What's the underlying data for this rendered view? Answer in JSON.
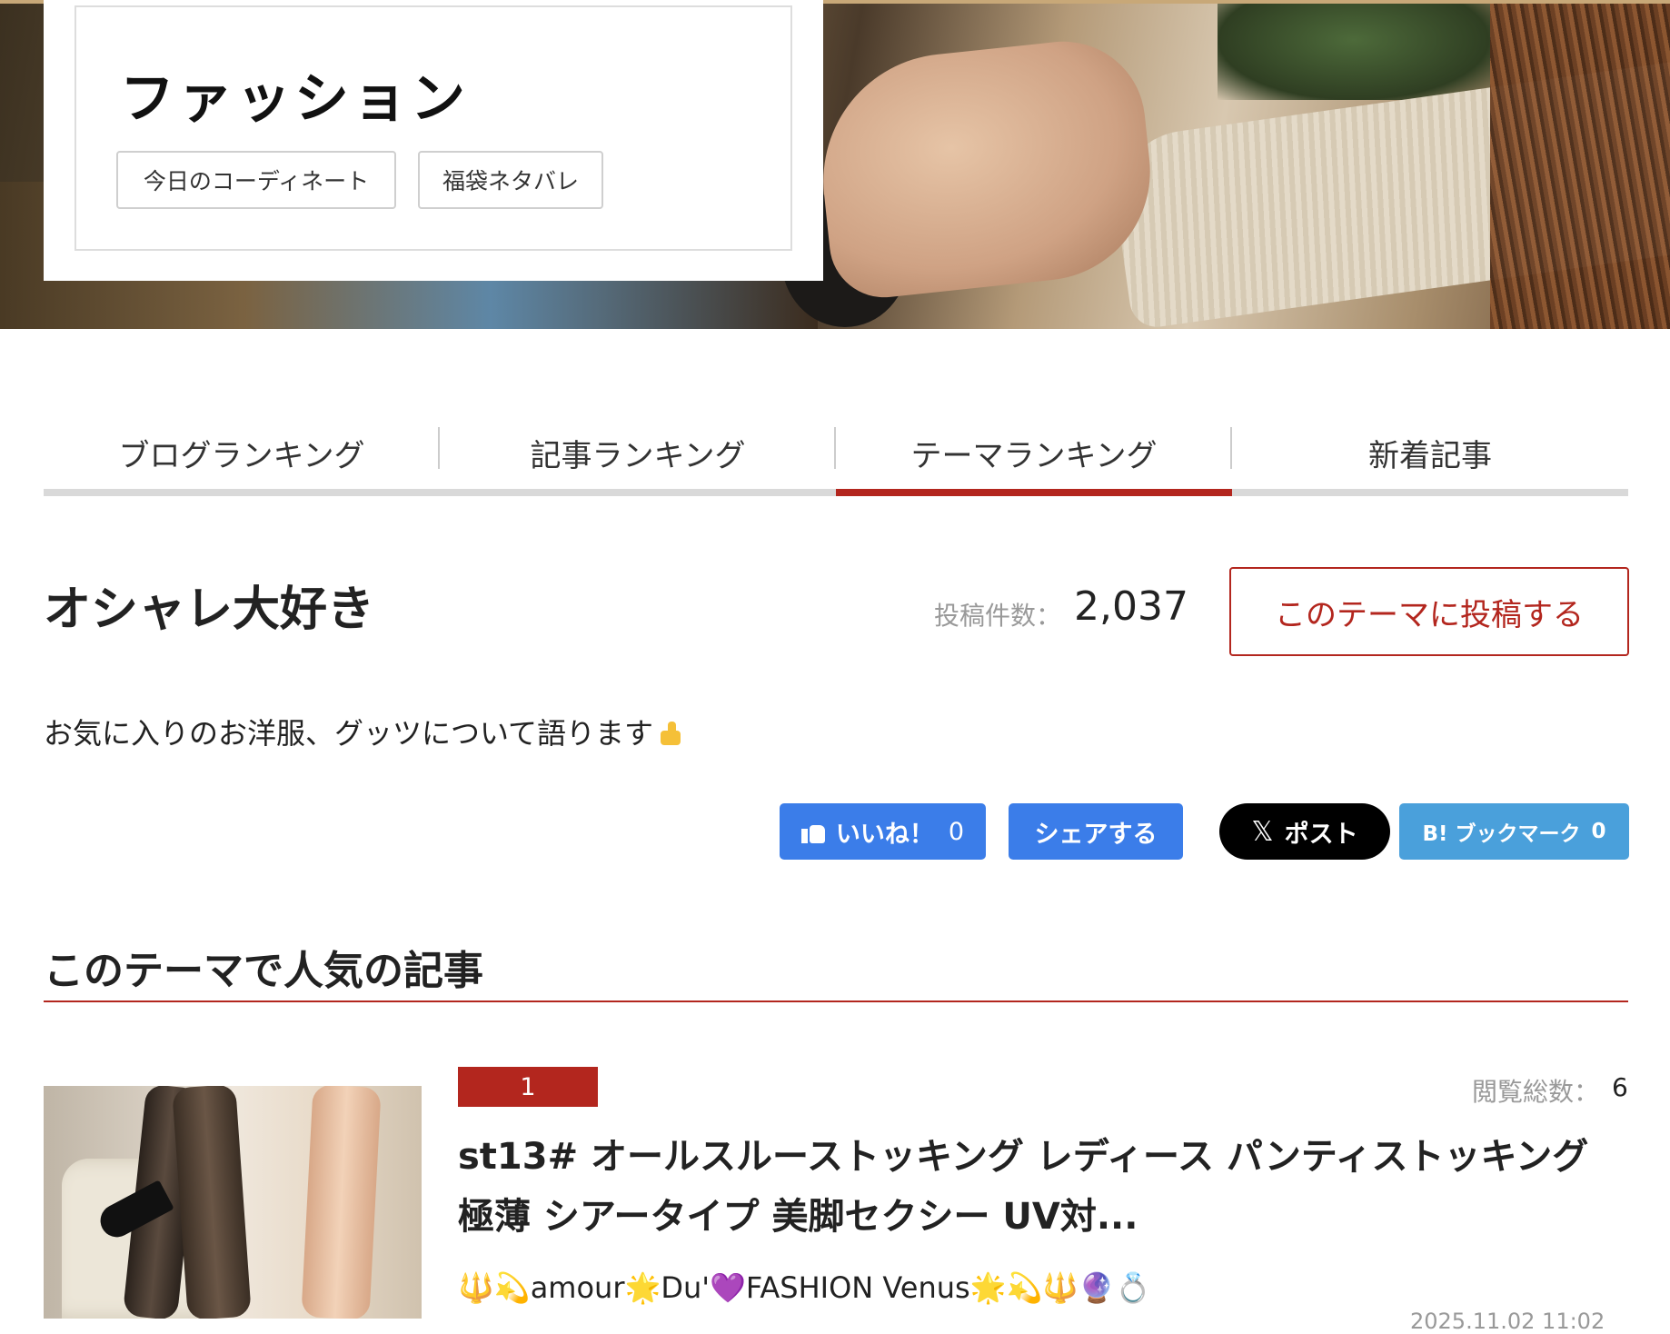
{
  "hero": {
    "category_title": "ファッション",
    "tags": [
      "今日のコーディネート",
      "福袋ネタバレ"
    ]
  },
  "tabs": [
    {
      "label": "ブログランキング",
      "active": false
    },
    {
      "label": "記事ランキング",
      "active": false
    },
    {
      "label": "テーマランキング",
      "active": true
    },
    {
      "label": "新着記事",
      "active": false
    }
  ],
  "theme": {
    "title": "オシャレ大好き",
    "post_count_label": "投稿件数：",
    "post_count": "2,037",
    "post_button_label": "このテーマに投稿する",
    "description": "お気に入りのお洋服、グッツについて語ります"
  },
  "share": {
    "like_label": "いいね！",
    "like_count": "0",
    "share_label": "シェアする",
    "x_icon": "𝕏",
    "x_label": "ポスト",
    "hatena_label": "B! ブックマーク",
    "hatena_count": "0"
  },
  "popular": {
    "heading": "このテーマで人気の記事",
    "articles": [
      {
        "rank": "1",
        "views_label": "閲覧総数：",
        "views": "6",
        "title": "st13# オールスルーストッキング レディース パンティストッキング 極薄 シアータイプ 美脚セクシー UV対...",
        "blog": "🔱💫amour🌟Du'💜FASHION Venus🌟💫🔱🔮💍",
        "date": "2025.11.02 11:02"
      }
    ]
  },
  "colors": {
    "accent_red": "#b3261e",
    "facebook_blue": "#3b7de9",
    "hatena_blue": "#4aa0db",
    "x_black": "#000000"
  }
}
